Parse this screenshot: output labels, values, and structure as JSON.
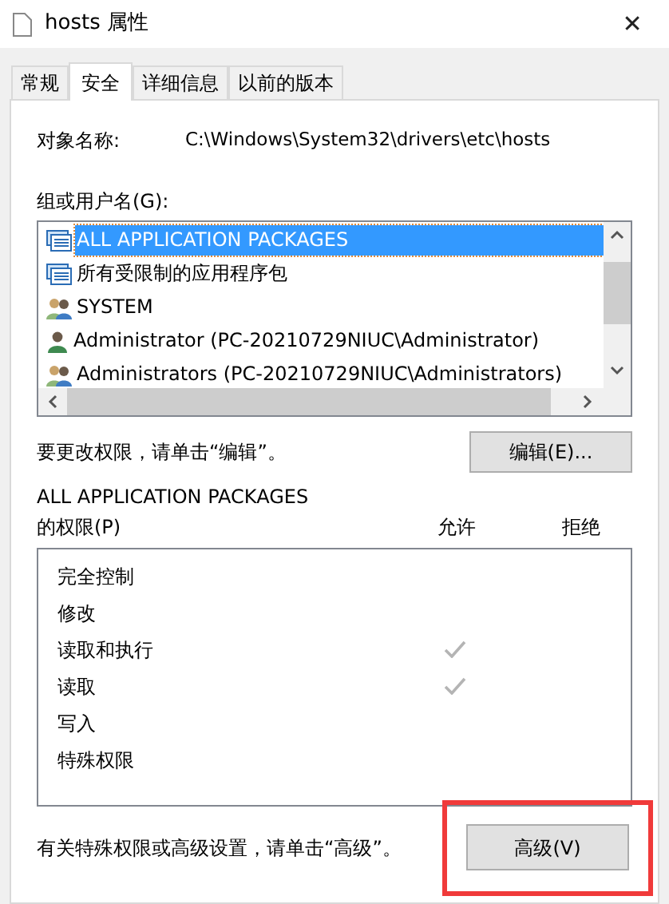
{
  "window": {
    "title": "hosts 属性",
    "close": "✕"
  },
  "tabs": [
    {
      "label": "常规",
      "selected": false
    },
    {
      "label": "安全",
      "selected": true
    },
    {
      "label": "详细信息",
      "selected": false
    },
    {
      "label": "以前的版本",
      "selected": false
    }
  ],
  "object_name": {
    "label": "对象名称:",
    "value": "C:\\Windows\\System32\\drivers\\etc\\hosts"
  },
  "groups": {
    "label": "组或用户名(G):",
    "items": [
      {
        "kind": "package",
        "name": "ALL APPLICATION PACKAGES",
        "selected": true
      },
      {
        "kind": "package",
        "name": "所有受限制的应用程序包",
        "selected": false
      },
      {
        "kind": "group",
        "name": "SYSTEM",
        "selected": false
      },
      {
        "kind": "user",
        "name": "Administrator (PC-20210729NIUC\\Administrator)",
        "selected": false
      },
      {
        "kind": "group",
        "name": "Administrators (PC-20210729NIUC\\Administrators)",
        "selected": false
      }
    ]
  },
  "edit_hint": "要更改权限，请单击“编辑”。",
  "edit_button": "编辑(E)...",
  "permissions": {
    "heading_line_1": "ALL APPLICATION PACKAGES",
    "heading_line_2": "的权限(P)",
    "allow_header": "允许",
    "deny_header": "拒绝",
    "rows": [
      {
        "name": "完全控制",
        "allow": false
      },
      {
        "name": "修改",
        "allow": false
      },
      {
        "name": "读取和执行",
        "allow": true
      },
      {
        "name": "读取",
        "allow": true
      },
      {
        "name": "写入",
        "allow": false
      },
      {
        "name": "特殊权限",
        "allow": false
      }
    ]
  },
  "advanced_hint": "有关特殊权限或高级设置，请单击“高级”。",
  "advanced_button": {
    "label": "高级(V)",
    "highlighted": true
  }
}
